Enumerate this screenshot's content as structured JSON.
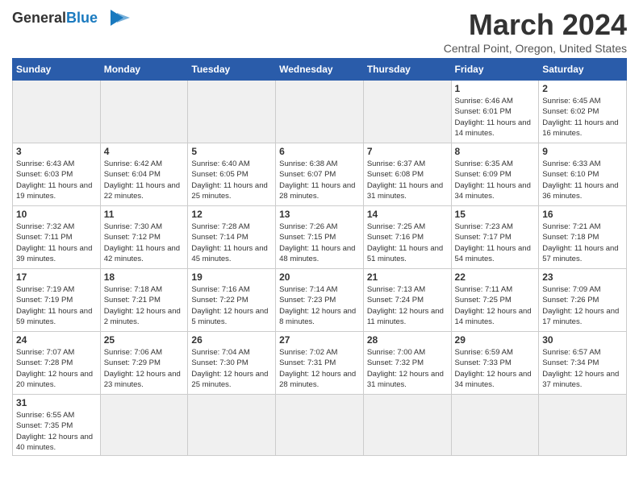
{
  "header": {
    "logo_general": "General",
    "logo_blue": "Blue",
    "month_title": "March 2024",
    "location": "Central Point, Oregon, United States"
  },
  "weekdays": [
    "Sunday",
    "Monday",
    "Tuesday",
    "Wednesday",
    "Thursday",
    "Friday",
    "Saturday"
  ],
  "weeks": [
    [
      {
        "day": "",
        "info": ""
      },
      {
        "day": "",
        "info": ""
      },
      {
        "day": "",
        "info": ""
      },
      {
        "day": "",
        "info": ""
      },
      {
        "day": "",
        "info": ""
      },
      {
        "day": "1",
        "info": "Sunrise: 6:46 AM\nSunset: 6:01 PM\nDaylight: 11 hours and 14 minutes."
      },
      {
        "day": "2",
        "info": "Sunrise: 6:45 AM\nSunset: 6:02 PM\nDaylight: 11 hours and 16 minutes."
      }
    ],
    [
      {
        "day": "3",
        "info": "Sunrise: 6:43 AM\nSunset: 6:03 PM\nDaylight: 11 hours and 19 minutes."
      },
      {
        "day": "4",
        "info": "Sunrise: 6:42 AM\nSunset: 6:04 PM\nDaylight: 11 hours and 22 minutes."
      },
      {
        "day": "5",
        "info": "Sunrise: 6:40 AM\nSunset: 6:05 PM\nDaylight: 11 hours and 25 minutes."
      },
      {
        "day": "6",
        "info": "Sunrise: 6:38 AM\nSunset: 6:07 PM\nDaylight: 11 hours and 28 minutes."
      },
      {
        "day": "7",
        "info": "Sunrise: 6:37 AM\nSunset: 6:08 PM\nDaylight: 11 hours and 31 minutes."
      },
      {
        "day": "8",
        "info": "Sunrise: 6:35 AM\nSunset: 6:09 PM\nDaylight: 11 hours and 34 minutes."
      },
      {
        "day": "9",
        "info": "Sunrise: 6:33 AM\nSunset: 6:10 PM\nDaylight: 11 hours and 36 minutes."
      }
    ],
    [
      {
        "day": "10",
        "info": "Sunrise: 7:32 AM\nSunset: 7:11 PM\nDaylight: 11 hours and 39 minutes."
      },
      {
        "day": "11",
        "info": "Sunrise: 7:30 AM\nSunset: 7:12 PM\nDaylight: 11 hours and 42 minutes."
      },
      {
        "day": "12",
        "info": "Sunrise: 7:28 AM\nSunset: 7:14 PM\nDaylight: 11 hours and 45 minutes."
      },
      {
        "day": "13",
        "info": "Sunrise: 7:26 AM\nSunset: 7:15 PM\nDaylight: 11 hours and 48 minutes."
      },
      {
        "day": "14",
        "info": "Sunrise: 7:25 AM\nSunset: 7:16 PM\nDaylight: 11 hours and 51 minutes."
      },
      {
        "day": "15",
        "info": "Sunrise: 7:23 AM\nSunset: 7:17 PM\nDaylight: 11 hours and 54 minutes."
      },
      {
        "day": "16",
        "info": "Sunrise: 7:21 AM\nSunset: 7:18 PM\nDaylight: 11 hours and 57 minutes."
      }
    ],
    [
      {
        "day": "17",
        "info": "Sunrise: 7:19 AM\nSunset: 7:19 PM\nDaylight: 11 hours and 59 minutes."
      },
      {
        "day": "18",
        "info": "Sunrise: 7:18 AM\nSunset: 7:21 PM\nDaylight: 12 hours and 2 minutes."
      },
      {
        "day": "19",
        "info": "Sunrise: 7:16 AM\nSunset: 7:22 PM\nDaylight: 12 hours and 5 minutes."
      },
      {
        "day": "20",
        "info": "Sunrise: 7:14 AM\nSunset: 7:23 PM\nDaylight: 12 hours and 8 minutes."
      },
      {
        "day": "21",
        "info": "Sunrise: 7:13 AM\nSunset: 7:24 PM\nDaylight: 12 hours and 11 minutes."
      },
      {
        "day": "22",
        "info": "Sunrise: 7:11 AM\nSunset: 7:25 PM\nDaylight: 12 hours and 14 minutes."
      },
      {
        "day": "23",
        "info": "Sunrise: 7:09 AM\nSunset: 7:26 PM\nDaylight: 12 hours and 17 minutes."
      }
    ],
    [
      {
        "day": "24",
        "info": "Sunrise: 7:07 AM\nSunset: 7:28 PM\nDaylight: 12 hours and 20 minutes."
      },
      {
        "day": "25",
        "info": "Sunrise: 7:06 AM\nSunset: 7:29 PM\nDaylight: 12 hours and 23 minutes."
      },
      {
        "day": "26",
        "info": "Sunrise: 7:04 AM\nSunset: 7:30 PM\nDaylight: 12 hours and 25 minutes."
      },
      {
        "day": "27",
        "info": "Sunrise: 7:02 AM\nSunset: 7:31 PM\nDaylight: 12 hours and 28 minutes."
      },
      {
        "day": "28",
        "info": "Sunrise: 7:00 AM\nSunset: 7:32 PM\nDaylight: 12 hours and 31 minutes."
      },
      {
        "day": "29",
        "info": "Sunrise: 6:59 AM\nSunset: 7:33 PM\nDaylight: 12 hours and 34 minutes."
      },
      {
        "day": "30",
        "info": "Sunrise: 6:57 AM\nSunset: 7:34 PM\nDaylight: 12 hours and 37 minutes."
      }
    ],
    [
      {
        "day": "31",
        "info": "Sunrise: 6:55 AM\nSunset: 7:35 PM\nDaylight: 12 hours and 40 minutes."
      },
      {
        "day": "",
        "info": ""
      },
      {
        "day": "",
        "info": ""
      },
      {
        "day": "",
        "info": ""
      },
      {
        "day": "",
        "info": ""
      },
      {
        "day": "",
        "info": ""
      },
      {
        "day": "",
        "info": ""
      }
    ]
  ]
}
